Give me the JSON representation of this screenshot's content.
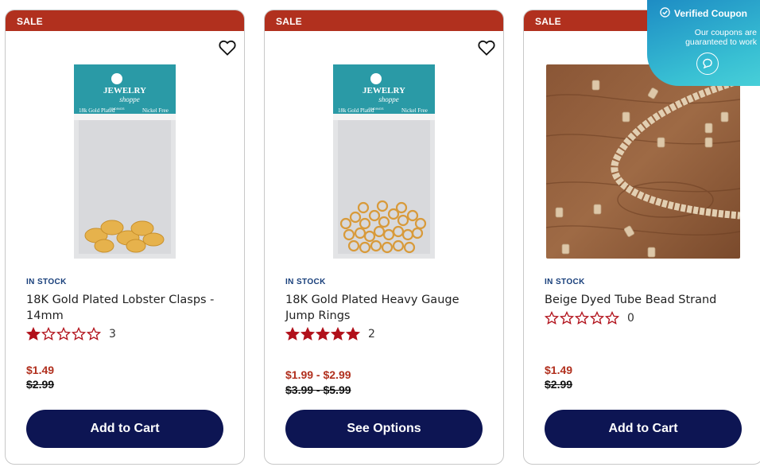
{
  "products": [
    {
      "badge": "SALE",
      "image": "gold-lobster-clasps-package",
      "stock": "IN STOCK",
      "title": "18K Gold Plated Lobster Clasps - 14mm",
      "rating": 1,
      "review_count": "3",
      "price": "$1.49",
      "original_price": "$2.99",
      "action": "Add to Cart"
    },
    {
      "badge": "SALE",
      "image": "gold-jump-rings-package",
      "stock": "IN STOCK",
      "title": "18K Gold Plated Heavy Gauge Jump Rings",
      "rating": 5,
      "review_count": "2",
      "price": "$1.99 - $2.99",
      "original_price": "$3.99 - $5.99",
      "action": "See Options"
    },
    {
      "badge": "SALE",
      "image": "beige-tube-bead-strand-photo",
      "stock": "IN STOCK",
      "title": "Beige Dyed Tube Bead Strand",
      "rating": 0,
      "review_count": "0",
      "price": "$1.49",
      "original_price": "$2.99",
      "action": "Add to Cart"
    }
  ],
  "package_label": {
    "brand_top": "JEWELRY",
    "brand_bottom": "shoppe",
    "finish": "18k Gold Plated",
    "tag": "Nickel Free",
    "findings": "FINDINGS"
  },
  "coupon": {
    "title": "Verified Coupon",
    "subtitle": "Our coupons are guaranteed to work"
  },
  "colors": {
    "sale_red": "#b1301e",
    "stock_blue": "#173e7a",
    "button_navy": "#0d1553",
    "star_red": "#b1101a"
  }
}
